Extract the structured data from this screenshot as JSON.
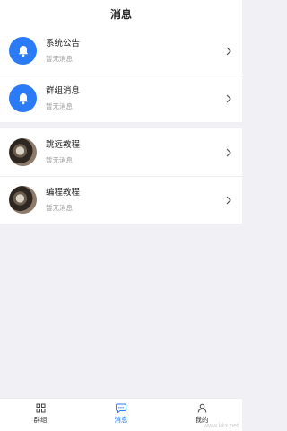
{
  "header": {
    "title": "消息"
  },
  "groups": [
    {
      "items": [
        {
          "name": "系统公告",
          "sub": "暂无消息",
          "avatar": "bell-icon"
        },
        {
          "name": "群组消息",
          "sub": "暂无消息",
          "avatar": "bell-icon"
        }
      ]
    },
    {
      "items": [
        {
          "name": "跳远教程",
          "sub": "暂无消息",
          "avatar": "photo"
        },
        {
          "name": "编程教程",
          "sub": "暂无消息",
          "avatar": "photo"
        }
      ]
    }
  ],
  "tabbar": {
    "tabs": [
      {
        "label": "群组",
        "icon": "grid-icon",
        "active": false
      },
      {
        "label": "消息",
        "icon": "chat-bubble-icon",
        "active": true
      },
      {
        "label": "我的",
        "icon": "user-icon",
        "active": false
      }
    ]
  },
  "colors": {
    "accent": "#2b7bf6",
    "bg": "#f0f0f5"
  },
  "watermark": "www.kkx.net"
}
